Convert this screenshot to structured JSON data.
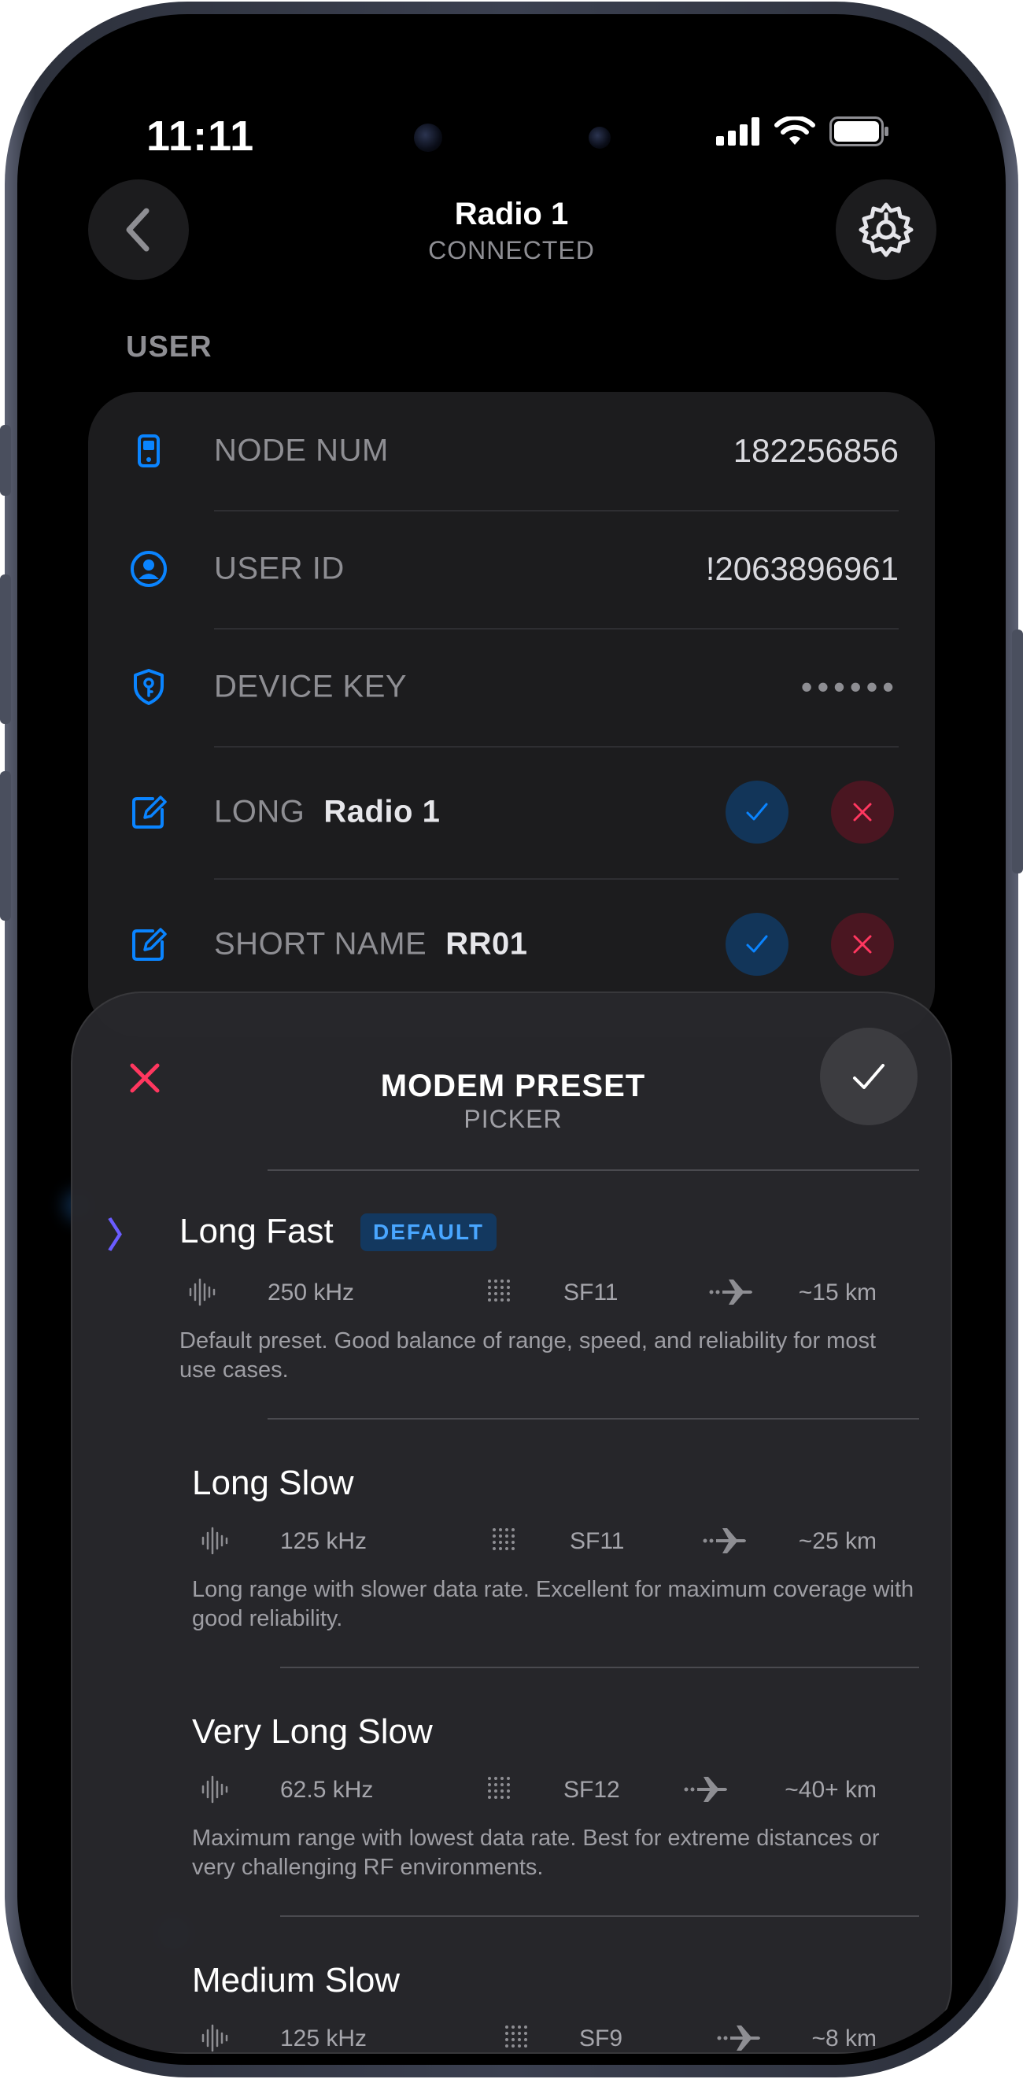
{
  "status_bar": {
    "time": "11:11"
  },
  "header": {
    "title": "Radio 1",
    "subtitle": "CONNECTED"
  },
  "section": {
    "label": "USER"
  },
  "user_rows": [
    {
      "label": "NODE NUM",
      "value": "182256856",
      "icon": "phone-device-icon"
    },
    {
      "label": "USER ID",
      "value": "!2063896961",
      "icon": "user-circle-icon"
    },
    {
      "label": "DEVICE KEY",
      "value": "••••••",
      "icon": "key-shield-icon"
    },
    {
      "label": "LONG",
      "value": "Radio 1",
      "icon": "edit-icon"
    },
    {
      "label": "SHORT NAME",
      "value": "RR01",
      "icon": "edit-icon"
    }
  ],
  "sheet": {
    "title": "MODEM PRESET",
    "subtitle": "PICKER",
    "presets": [
      {
        "name": "Long Fast",
        "badge": "DEFAULT",
        "bandwidth": "250 kHz",
        "sf": "SF11",
        "range": "~15 km",
        "description": "Default preset. Good balance of range, speed, and reliability for most use cases.",
        "selected": true
      },
      {
        "name": "Long Slow",
        "bandwidth": "125 kHz",
        "sf": "SF11",
        "range": "~25 km",
        "description": "Long range with slower data rate. Excellent for maximum coverage with good reliability."
      },
      {
        "name": "Very Long Slow",
        "bandwidth": "62.5 kHz",
        "sf": "SF12",
        "range": "~40+ km",
        "description": "Maximum range with lowest data rate. Best for extreme distances or very challenging RF environments."
      },
      {
        "name": "Medium Slow",
        "bandwidth": "125 kHz",
        "sf": "SF9",
        "range": "~8 km"
      }
    ]
  },
  "colors": {
    "accent": "#0a84ff",
    "danger": "#ff375f",
    "badge_text": "#49a6ff",
    "chevron": "#6a5cff"
  }
}
